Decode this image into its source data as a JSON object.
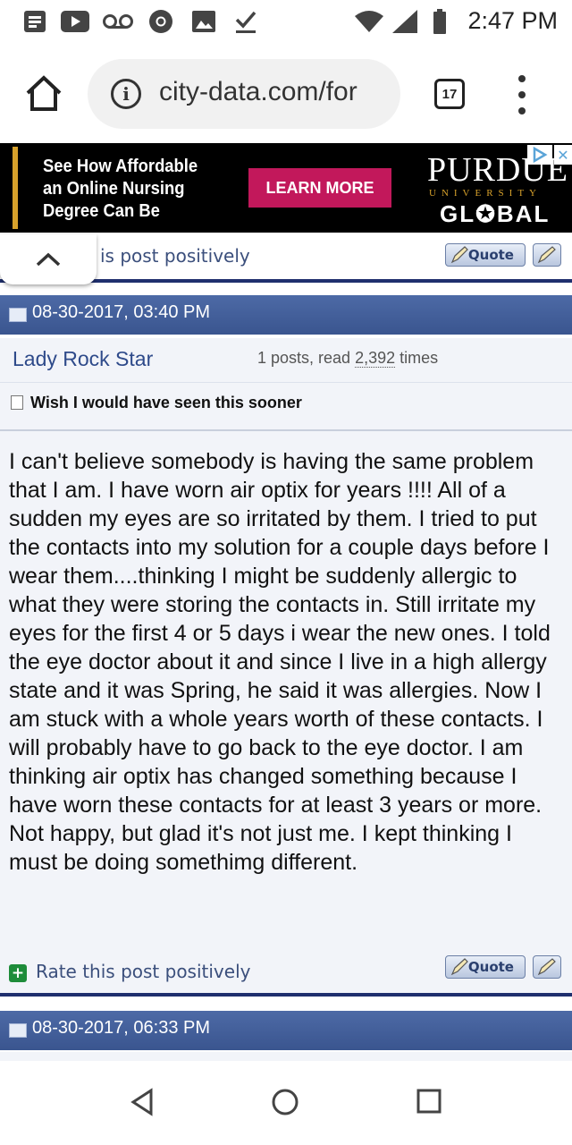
{
  "status_bar": {
    "time": "2:47 PM",
    "icons": [
      "notification-icon",
      "youtube-icon",
      "voicemail-icon",
      "chrome-icon",
      "image-icon",
      "download-complete-icon",
      "wifi-icon",
      "signal-icon",
      "battery-icon"
    ]
  },
  "browser": {
    "url": "city-data.com/for",
    "tab_count": "17"
  },
  "ad": {
    "text": "See How Affordable an Online Nursing Degree Can Be",
    "button": "LEARN MORE",
    "brand": "PURDUE",
    "brand_sub": "UNIVERSITY",
    "brand_global": "GL✪BAL"
  },
  "prev_post": {
    "rate_partial": "is post positively",
    "quote_label": "Quote"
  },
  "post": {
    "date": "08-30-2017, 03:40 PM",
    "username": "Lady Rock Star",
    "stats_prefix": "1 posts, read ",
    "stats_count": "2,392",
    "stats_suffix": " times",
    "title": "Wish I would have seen this sooner",
    "body": "I can't believe somebody is having the same problem that I am. I have worn air optix for years !!!! All of a sudden my eyes are so irritated by them. I tried to put the contacts into my solution for a couple days before I wear them....thinking I might be suddenly allergic to what they were storing the contacts in. Still irritate my eyes for the first 4 or 5 days i wear the new ones. I told the eye doctor about it and since I live in a high allergy state and it was Spring, he said it was allergies. Now I am stuck with a whole years worth of these contacts. I will probably have to go back to the eye doctor. I am thinking air optix has changed something because I have worn these contacts for at least 3 years or more. Not happy, but glad it's not just me. I kept thinking I must be doing somethimg different.",
    "rate_label": "Rate this post positively",
    "quote_label": "Quote"
  },
  "next_post": {
    "date": "08-30-2017, 06:33 PM"
  },
  "colors": {
    "header_blue": "#3f5b96",
    "link_blue": "#2e4a8a",
    "ad_pink": "#c2185b",
    "ad_gold": "#d7a12b"
  }
}
